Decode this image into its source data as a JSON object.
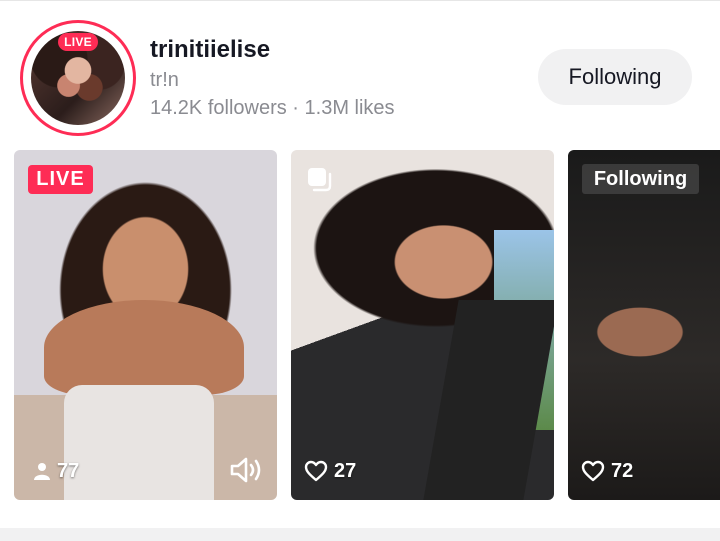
{
  "profile": {
    "avatar_badge": "LIVE",
    "username": "trinitiielise",
    "nickname": "tr!n",
    "stats": "14.2K followers · 1.3M likes",
    "follow_button": "Following"
  },
  "cards": [
    {
      "badge": "LIVE",
      "count": "77",
      "count_icon": "person-icon",
      "extra_icon": "speaker-icon"
    },
    {
      "badge_icon": "multi-photo-icon",
      "count": "27",
      "count_icon": "heart-icon"
    },
    {
      "badge": "Following",
      "count": "72",
      "count_icon": "heart-icon"
    }
  ],
  "colors": {
    "accent": "#fe2c55",
    "button_bg": "#f1f1f2",
    "muted_text": "#8a8b91"
  }
}
